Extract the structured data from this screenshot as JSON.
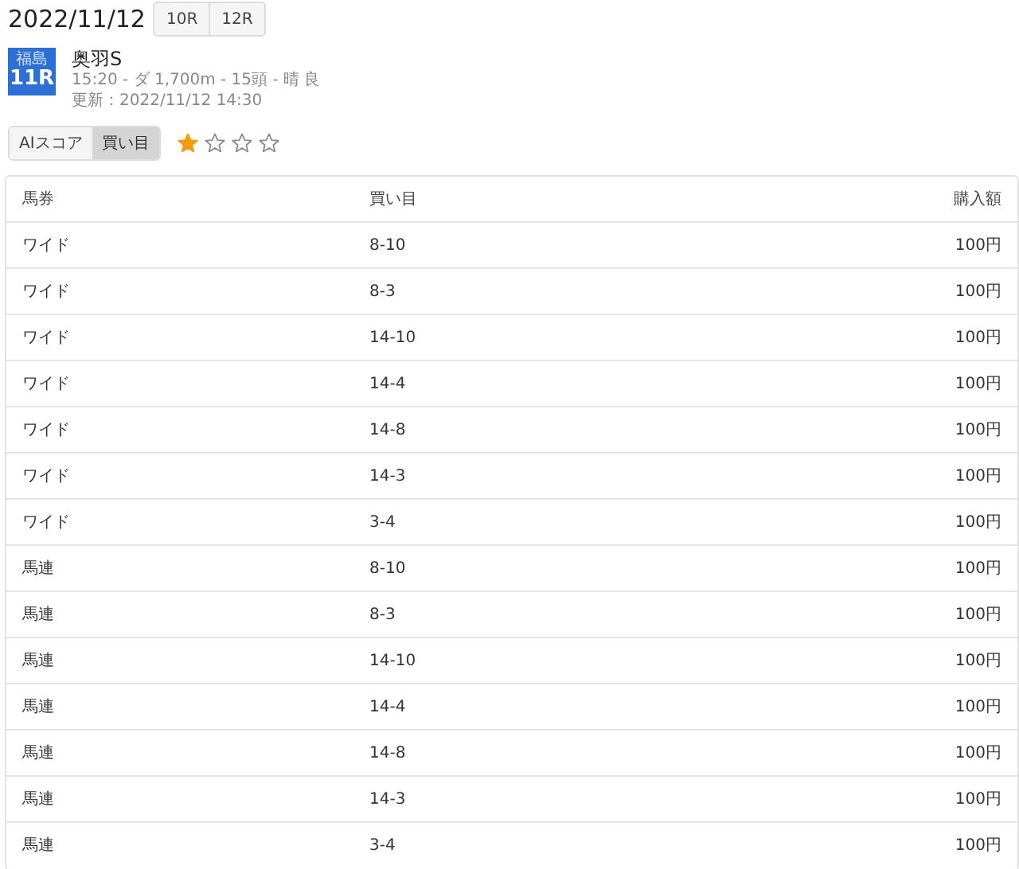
{
  "date": "2022/11/12",
  "race_tabs": [
    {
      "label": "10R"
    },
    {
      "label": "12R"
    }
  ],
  "race": {
    "venue": "福島",
    "number": "11R",
    "name": "奥羽S",
    "details": "15:20 - ダ 1,700m - 15頭 - 晴 良",
    "updated": "更新：2022/11/12 14:30"
  },
  "view_tabs": [
    {
      "label": "AIスコア",
      "selected": false
    },
    {
      "label": "買い目",
      "selected": true
    }
  ],
  "rating": {
    "stars": 1
  },
  "table": {
    "columns": [
      "馬券",
      "買い目",
      "購入額"
    ],
    "rows": [
      [
        "ワイド",
        "8-10",
        "100円"
      ],
      [
        "ワイド",
        "8-3",
        "100円"
      ],
      [
        "ワイド",
        "14-10",
        "100円"
      ],
      [
        "ワイド",
        "14-4",
        "100円"
      ],
      [
        "ワイド",
        "14-8",
        "100円"
      ],
      [
        "ワイド",
        "14-3",
        "100円"
      ],
      [
        "ワイド",
        "3-4",
        "100円"
      ],
      [
        "馬連",
        "8-10",
        "100円"
      ],
      [
        "馬連",
        "8-3",
        "100円"
      ],
      [
        "馬連",
        "14-10",
        "100円"
      ],
      [
        "馬連",
        "14-4",
        "100円"
      ],
      [
        "馬連",
        "14-8",
        "100円"
      ],
      [
        "馬連",
        "14-3",
        "100円"
      ],
      [
        "馬連",
        "3-4",
        "100円"
      ]
    ]
  }
}
